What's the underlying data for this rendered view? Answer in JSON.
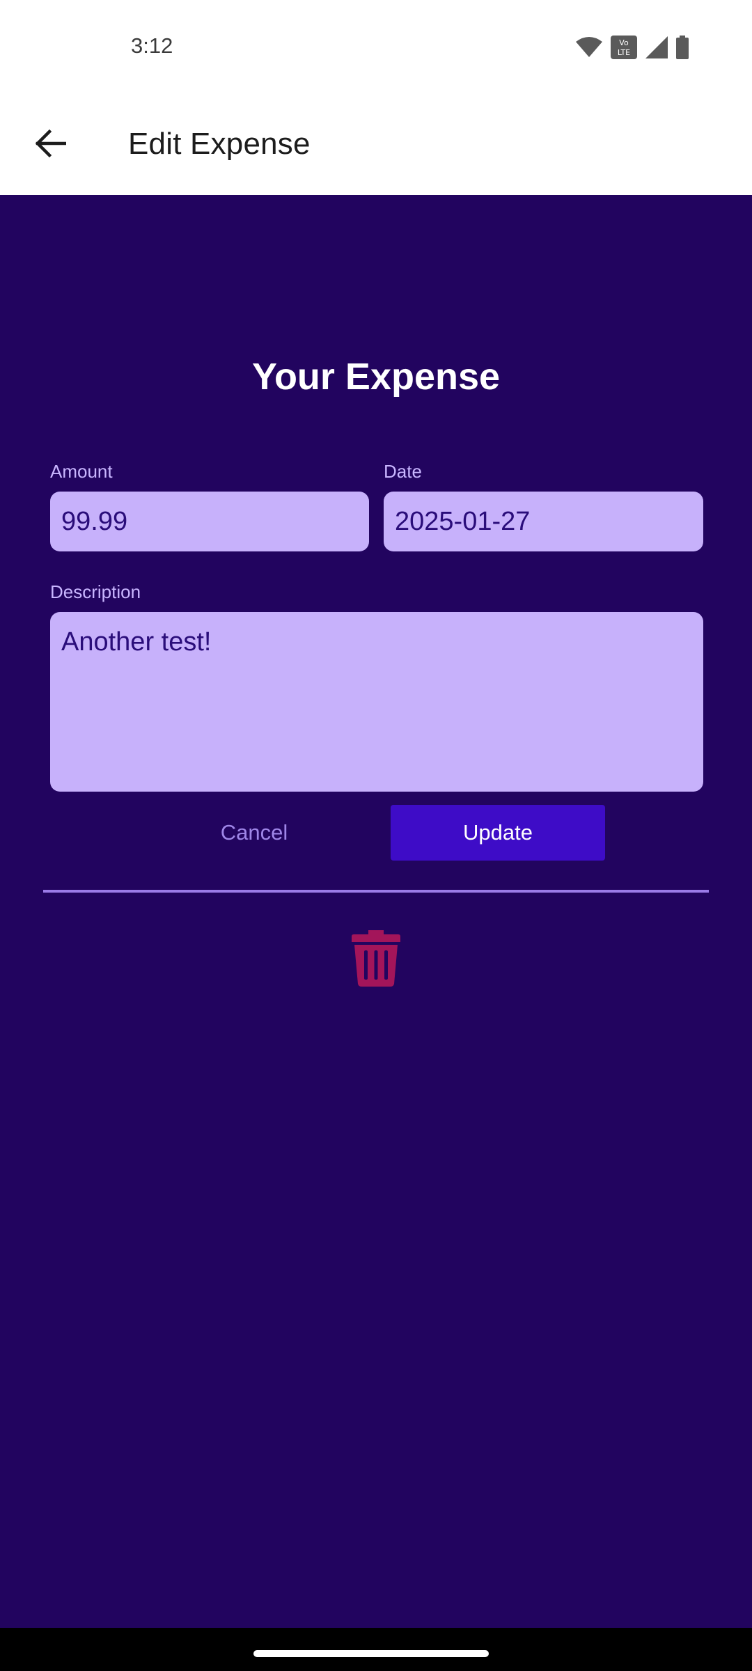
{
  "status_bar": {
    "time": "3:12",
    "icons": [
      "wifi-icon",
      "volte-icon",
      "signal-icon",
      "battery-icon"
    ],
    "volte_label": "Vo LTE"
  },
  "app_bar": {
    "title": "Edit Expense",
    "back_icon": "arrow-left-icon"
  },
  "form": {
    "heading": "Your Expense",
    "amount": {
      "label": "Amount",
      "value": "99.99"
    },
    "date": {
      "label": "Date",
      "value": "2025-01-27"
    },
    "description": {
      "label": "Description",
      "value": "Another test!"
    },
    "cancel_label": "Cancel",
    "update_label": "Update",
    "delete_icon": "trash-icon"
  },
  "colors": {
    "background": "#22045f",
    "field": "#c7b1fb",
    "primary_button": "#3e0cc7",
    "delete": "#a3155a",
    "divider": "#9b7be8"
  }
}
